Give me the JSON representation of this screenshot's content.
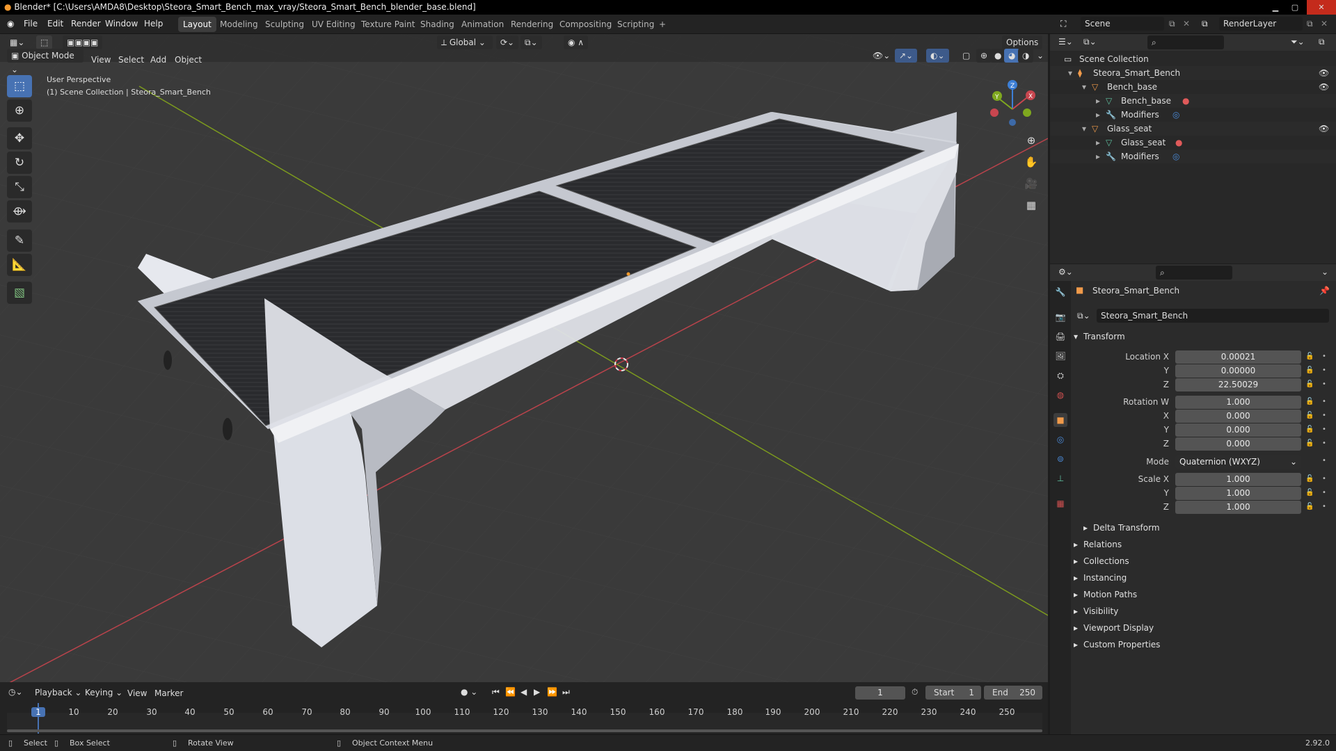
{
  "app": {
    "title": "Blender* [C:\\Users\\AMDA8\\Desktop\\Steora_Smart_Bench_max_vray/Steora_Smart_Bench_blender_base.blend]",
    "version": "2.92.0"
  },
  "menu": [
    "File",
    "Edit",
    "Render",
    "Window",
    "Help"
  ],
  "workspaces": [
    "Layout",
    "Modeling",
    "Sculpting",
    "UV Editing",
    "Texture Paint",
    "Shading",
    "Animation",
    "Rendering",
    "Compositing",
    "Scripting"
  ],
  "active_workspace": "Layout",
  "scene": {
    "name": "Scene",
    "view_layer": "RenderLayer"
  },
  "viewport": {
    "header": {
      "mode": "Object Mode",
      "menus": [
        "View",
        "Select",
        "Add",
        "Object"
      ],
      "orientation": "Global",
      "options": "Options"
    },
    "overlay_text": {
      "perspective": "User Perspective",
      "collection": "(1) Scene Collection | Steora_Smart_Bench"
    },
    "gizmo_axes": [
      "X",
      "Y",
      "Z"
    ]
  },
  "outliner": {
    "root": "Scene Collection",
    "items": [
      {
        "label": "Steora_Smart_Bench",
        "depth": 1
      },
      {
        "label": "Bench_base",
        "depth": 2
      },
      {
        "label": "Bench_base",
        "depth": 3
      },
      {
        "label": "Modifiers",
        "depth": 3
      },
      {
        "label": "Glass_seat",
        "depth": 2
      },
      {
        "label": "Glass_seat",
        "depth": 3
      },
      {
        "label": "Modifiers",
        "depth": 3
      }
    ]
  },
  "properties": {
    "object_name": "Steora_Smart_Bench",
    "data_name": "Steora_Smart_Bench",
    "transform": {
      "header": "Transform",
      "location_label": "Location X",
      "location": [
        "0.00021",
        "0.00000",
        "22.50029"
      ],
      "rotation_label": "Rotation W",
      "rotation": [
        "1.000",
        "0.000",
        "0.000",
        "0.000"
      ],
      "mode_label": "Mode",
      "mode": "Quaternion (WXYZ)",
      "scale_label": "Scale X",
      "scale": [
        "1.000",
        "1.000",
        "1.000"
      ],
      "axis_y": "Y",
      "axis_z": "Z",
      "axis_x": "X",
      "delta": "Delta Transform"
    },
    "panels": [
      "Relations",
      "Collections",
      "Instancing",
      "Motion Paths",
      "Visibility",
      "Viewport Display",
      "Custom Properties"
    ]
  },
  "timeline": {
    "menus": [
      "Playback",
      "Keying",
      "View",
      "Marker"
    ],
    "current_frame": "1",
    "start_label": "Start",
    "start": "1",
    "end_label": "End",
    "end": "250",
    "ticks": [
      "1",
      "10",
      "20",
      "30",
      "40",
      "50",
      "60",
      "70",
      "80",
      "90",
      "100",
      "110",
      "120",
      "130",
      "140",
      "150",
      "160",
      "170",
      "180",
      "190",
      "200",
      "210",
      "220",
      "230",
      "240",
      "250"
    ]
  },
  "statusbar": {
    "select": "Select",
    "box_select": "Box Select",
    "rotate_view": "Rotate View",
    "context_menu": "Object Context Menu"
  },
  "colors": {
    "accent": "#4772b3",
    "x_axis": "#c8464f",
    "y_axis": "#7fa81f",
    "z_axis": "#3d7fd6",
    "viewport_bg": "#393939"
  }
}
